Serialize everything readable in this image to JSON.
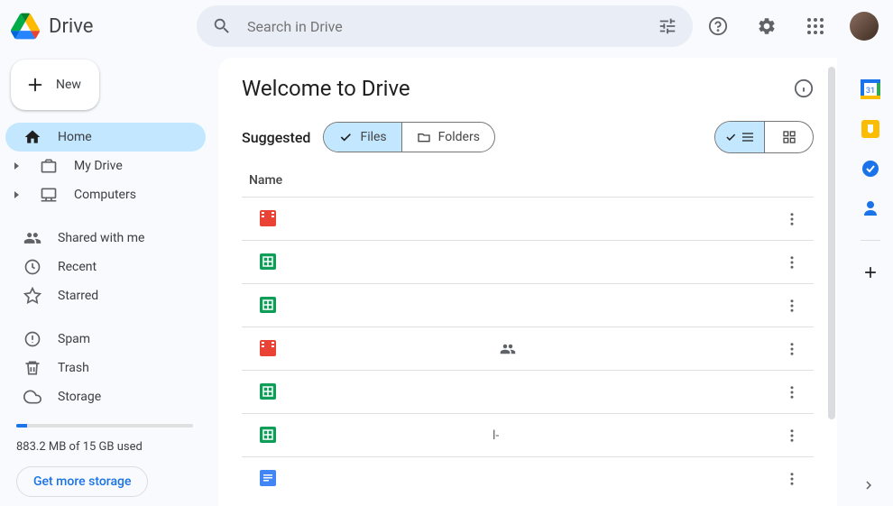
{
  "header": {
    "logo_text": "Drive",
    "search_placeholder": "Search in Drive"
  },
  "sidebar": {
    "new_label": "New",
    "nav": {
      "home": "Home",
      "my_drive": "My Drive",
      "computers": "Computers",
      "shared": "Shared with me",
      "recent": "Recent",
      "starred": "Starred",
      "spam": "Spam",
      "trash": "Trash",
      "storage": "Storage"
    },
    "storage_text": "883.2 MB of 15 GB used",
    "storage_btn": "Get more storage"
  },
  "main": {
    "welcome_title": "Welcome to Drive",
    "suggested_label": "Suggested",
    "files_label": "Files",
    "folders_label": "Folders",
    "name_header": "Name",
    "rows": [
      {
        "type": "video",
        "name": "",
        "shared": false,
        "extra": ""
      },
      {
        "type": "sheet",
        "name": "",
        "shared": false,
        "extra": ""
      },
      {
        "type": "sheet",
        "name": "",
        "shared": false,
        "extra": ""
      },
      {
        "type": "video",
        "name": "",
        "shared": true,
        "extra": ""
      },
      {
        "type": "sheet",
        "name": "",
        "shared": false,
        "extra": ""
      },
      {
        "type": "sheet",
        "name": "",
        "shared": false,
        "extra": "l-"
      },
      {
        "type": "doc",
        "name": "",
        "shared": false,
        "extra": ""
      }
    ]
  },
  "icons": {
    "calendar_num": "31"
  }
}
